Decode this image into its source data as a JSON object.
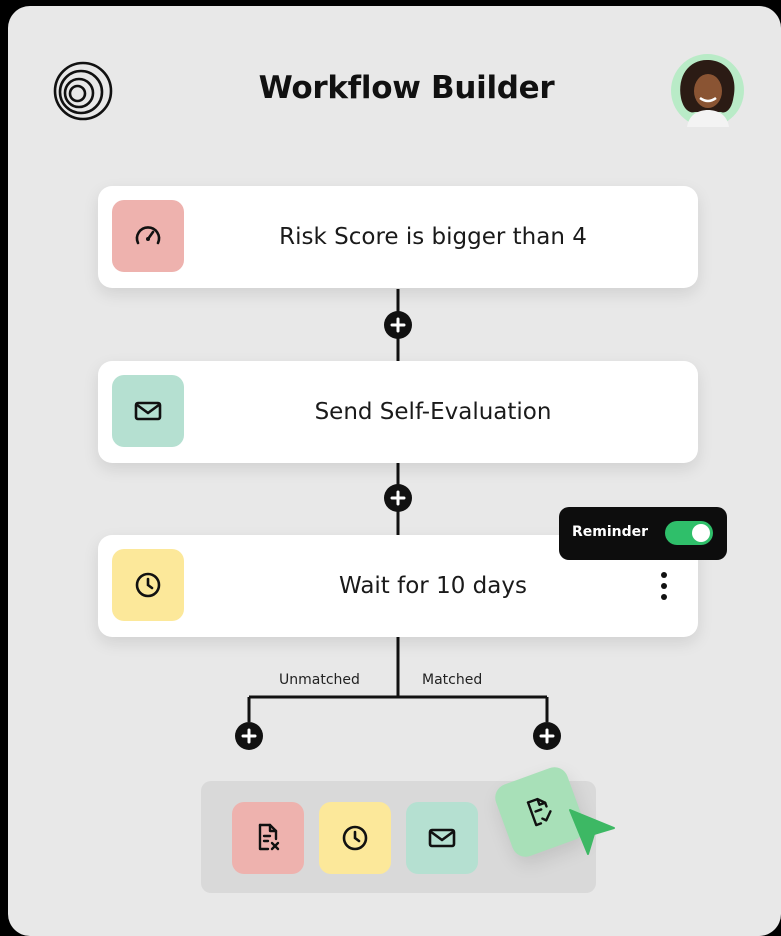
{
  "header": {
    "title": "Workflow Builder",
    "logo_icon": "concentric-circles-logo",
    "avatar_icon": "user-avatar"
  },
  "steps": [
    {
      "icon": "gauge-icon",
      "icon_bg": "#eeb2ae",
      "label": "Risk Score is bigger than 4"
    },
    {
      "icon": "mail-icon",
      "icon_bg": "#b5e0d1",
      "label": "Send Self-Evaluation"
    },
    {
      "icon": "clock-icon",
      "icon_bg": "#fce89a",
      "label": "Wait for 10 days"
    }
  ],
  "reminder": {
    "label": "Reminder",
    "enabled": true,
    "toggle_color": "#2fbf6a"
  },
  "branches": {
    "left_label": "Unmatched",
    "right_label": "Matched"
  },
  "tray": {
    "items": [
      {
        "icon": "file-remove-icon",
        "bg": "#eeb2ae"
      },
      {
        "icon": "clock-icon",
        "bg": "#fce89a"
      },
      {
        "icon": "mail-icon",
        "bg": "#b5e0d1"
      }
    ],
    "dragging_item": {
      "icon": "document-sign-icon",
      "bg": "#a8e0b8"
    }
  },
  "colors": {
    "panel_bg": "#e8e8e8",
    "outer_bg": "#000000",
    "connector": "#111111",
    "cursor": "#3db864"
  }
}
